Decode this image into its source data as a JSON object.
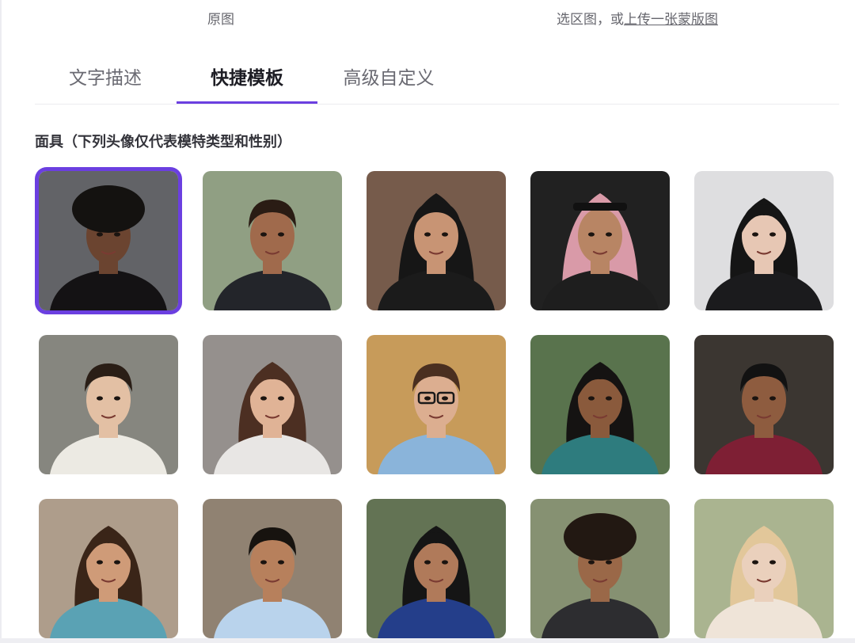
{
  "top": {
    "original_label": "原图",
    "selection_prefix": "选区图，或",
    "upload_link": "上传一张蒙版图"
  },
  "tabs": [
    {
      "label": "文字描述",
      "active": false
    },
    {
      "label": "快捷模板",
      "active": true
    },
    {
      "label": "高级自定义",
      "active": false
    }
  ],
  "section": {
    "title": "面具（下列头像仅代表模特类型和性别）"
  },
  "colors": {
    "accent": "#6b3fe0"
  },
  "portraits": [
    {
      "id": "portrait-01",
      "selected": true,
      "bg": "#595a5e",
      "skin": "#6b4430",
      "hair": "#141210",
      "shirt": "#141214",
      "style": "afro"
    },
    {
      "id": "portrait-02",
      "selected": false,
      "bg": "#8a9a7c",
      "skin": "#a06a4c",
      "hair": "#2a1c14",
      "shirt": "#23252a",
      "style": "short"
    },
    {
      "id": "portrait-03",
      "selected": false,
      "bg": "#6e5140",
      "skin": "#c89474",
      "hair": "#161616",
      "shirt": "#1b1b1b",
      "style": "hijab"
    },
    {
      "id": "portrait-04",
      "selected": false,
      "bg": "#141414",
      "skin": "#b88564",
      "hair": "#d99aa8",
      "shirt": "#1e1e1e",
      "style": "keffiyeh"
    },
    {
      "id": "portrait-05",
      "selected": false,
      "bg": "#dcdcdf",
      "skin": "#e7c7b4",
      "hair": "#151515",
      "shirt": "#1b1b1d",
      "style": "long"
    },
    {
      "id": "portrait-06",
      "selected": false,
      "bg": "#7f7f78",
      "skin": "#e3c0a4",
      "hair": "#2a1e16",
      "shirt": "#eceae3",
      "style": "short"
    },
    {
      "id": "portrait-07",
      "selected": false,
      "bg": "#8f8a86",
      "skin": "#e0b396",
      "hair": "#4c2f22",
      "shirt": "#e8e6e4",
      "style": "long"
    },
    {
      "id": "portrait-08",
      "selected": false,
      "bg": "#c49550",
      "skin": "#dcae90",
      "hair": "#4a2f20",
      "shirt": "#8ab4da",
      "style": "glasses"
    },
    {
      "id": "portrait-09",
      "selected": false,
      "bg": "#4f6b42",
      "skin": "#8a5a3c",
      "hair": "#151312",
      "shirt": "#2e7c7e",
      "style": "long"
    },
    {
      "id": "portrait-10",
      "selected": false,
      "bg": "#2f2a25",
      "skin": "#8e5c3f",
      "hair": "#121212",
      "shirt": "#7e1f34",
      "style": "short"
    },
    {
      "id": "portrait-11",
      "selected": false,
      "bg": "#a99784",
      "skin": "#cf9b78",
      "hair": "#3a2518",
      "shirt": "#5aa2b4",
      "style": "long"
    },
    {
      "id": "portrait-12",
      "selected": false,
      "bg": "#8a7b6a",
      "skin": "#b7805c",
      "hair": "#17130f",
      "shirt": "#b9d3ec",
      "style": "short"
    },
    {
      "id": "portrait-13",
      "selected": false,
      "bg": "#5a6b4a",
      "skin": "#b07a5a",
      "hair": "#151515",
      "shirt": "#243e8a",
      "style": "long"
    },
    {
      "id": "portrait-14",
      "selected": false,
      "bg": "#7f8b6a",
      "skin": "#9a6848",
      "hair": "#221812",
      "shirt": "#2d2d30",
      "style": "afro"
    },
    {
      "id": "portrait-15",
      "selected": false,
      "bg": "#a5b08a",
      "skin": "#ead0bc",
      "hair": "#e2c79a",
      "shirt": "#efe4d8",
      "style": "long"
    }
  ]
}
